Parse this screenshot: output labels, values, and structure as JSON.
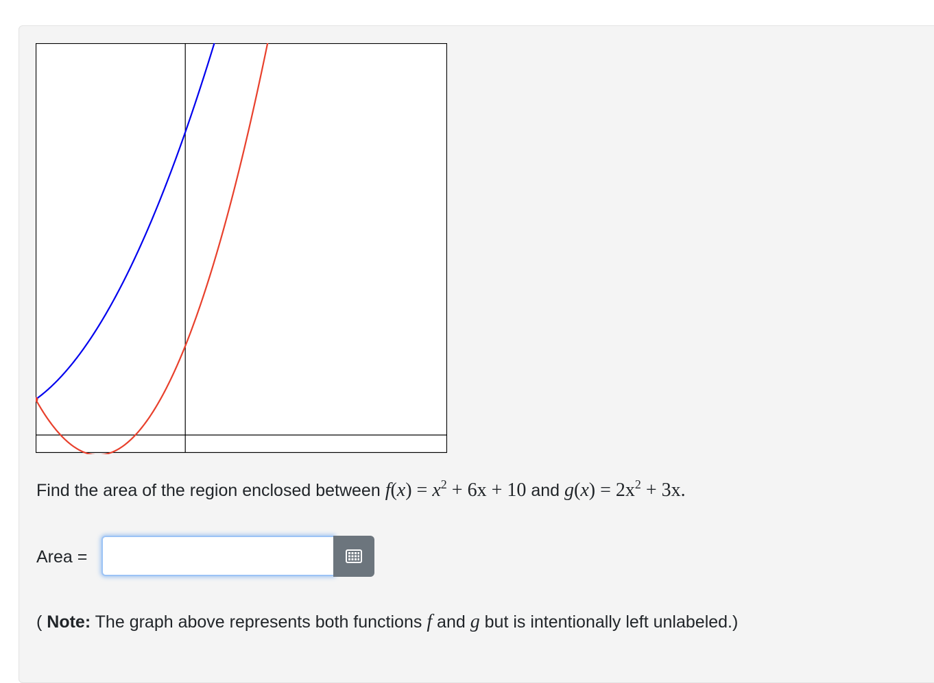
{
  "graph": {
    "x_range": [
      -2,
      6.25
    ],
    "y_range": [
      -1,
      22
    ],
    "axis_x_at_y": 0,
    "axis_y_at_x": 1,
    "curves": [
      {
        "name": "",
        "expr": "x^2 + 6x + 10",
        "color": "#0000ee",
        "coefficients": [
          1,
          6,
          10
        ]
      },
      {
        "name": "",
        "expr": "2x^2 + 3x",
        "color": "#e8402c",
        "coefficients": [
          2,
          3,
          0
        ]
      }
    ]
  },
  "question": {
    "prefix": "Find the area of the region enclosed between ",
    "f_label": "f",
    "f_rhs_1": "x",
    "f_rhs_2": " + 6x + 10",
    "and_text": " and ",
    "g_label": "g",
    "g_rhs_1": "2x",
    "g_rhs_2": " + 3x.",
    "exp": "2"
  },
  "answer": {
    "label": "Area =",
    "value": "",
    "keypad_icon": "keypad-icon"
  },
  "note": {
    "open": "( ",
    "bold": "Note:",
    "text1": " The graph above represents both functions ",
    "f": "f",
    "and": " and ",
    "g": "g",
    "text2": " but is intentionally left unlabeled.)"
  }
}
